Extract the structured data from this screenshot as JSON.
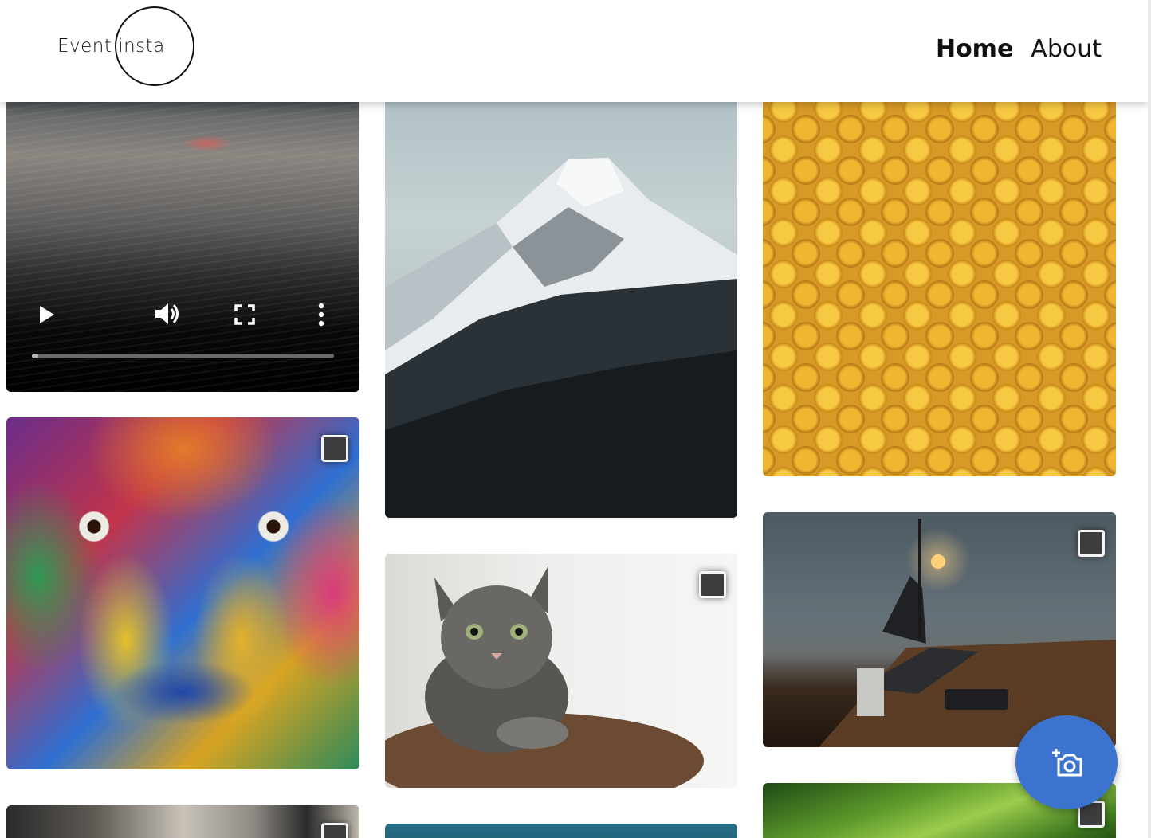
{
  "header": {
    "logo_text": "Event insta",
    "nav": [
      {
        "label": "Home",
        "active": true
      },
      {
        "label": "About",
        "active": false
      }
    ]
  },
  "gallery": {
    "tiles": [
      {
        "type": "video",
        "subject": "shoreline at dusk",
        "controls": [
          "play-icon",
          "volume-icon",
          "fullscreen-icon",
          "more-vert-icon"
        ],
        "progress": 0.02
      },
      {
        "type": "photo",
        "subject": "painted face",
        "selectable": true
      },
      {
        "type": "photo",
        "subject": "staircase",
        "selectable": true
      },
      {
        "type": "photo",
        "subject": "snowy mountain",
        "selectable": true
      },
      {
        "type": "photo",
        "subject": "tabby cat",
        "selectable": true
      },
      {
        "type": "photo",
        "subject": "sea",
        "selectable": true
      },
      {
        "type": "photo",
        "subject": "lego heads",
        "selectable": true
      },
      {
        "type": "photo",
        "subject": "desk with laptop and lamp",
        "selectable": true
      },
      {
        "type": "photo",
        "subject": "green leaf",
        "selectable": true
      }
    ]
  },
  "fab": {
    "icon": "add-photo-icon"
  },
  "colors": {
    "header_bg": "#ffffff",
    "text": "#111111",
    "fab": "#3c73cf",
    "checkbox_fill": "#3c3c3c",
    "checkbox_border": "#f4f4f4"
  }
}
